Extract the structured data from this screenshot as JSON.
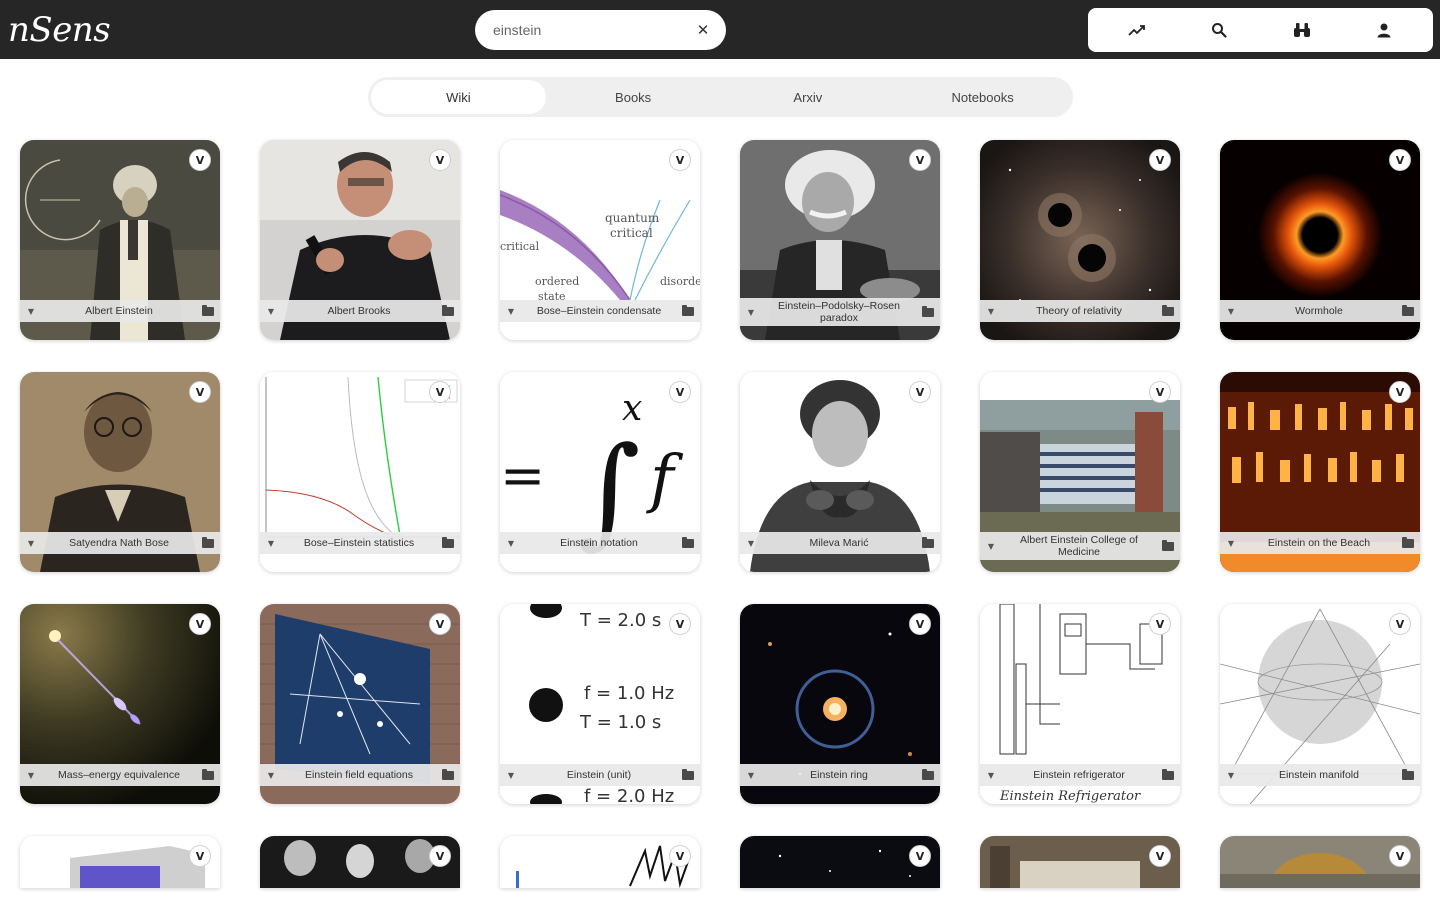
{
  "app": {
    "logo_text": "nSens"
  },
  "search": {
    "value": "einstein",
    "clear_icon": "close-icon",
    "clear_glyph": "✕"
  },
  "toolbar": {
    "icons": [
      "trending-icon",
      "search-icon",
      "binoculars-icon",
      "user-icon"
    ]
  },
  "tabs": [
    {
      "label": "Wiki",
      "active": true
    },
    {
      "label": "Books",
      "active": false
    },
    {
      "label": "Arxiv",
      "active": false
    },
    {
      "label": "Notebooks",
      "active": false
    }
  ],
  "card_badge": "V",
  "card_caption_left_glyph": "▼",
  "rows": [
    [
      {
        "title": "Albert Einstein"
      },
      {
        "title": "Albert Brooks"
      },
      {
        "title": "Bose–Einstein condensate"
      },
      {
        "title": "Einstein–Podolsky–Rosen paradox"
      },
      {
        "title": "Theory of relativity"
      },
      {
        "title": "Wormhole"
      }
    ],
    [
      {
        "title": "Satyendra Nath Bose"
      },
      {
        "title": "Bose–Einstein statistics"
      },
      {
        "title": "Einstein notation"
      },
      {
        "title": "Mileva Marić"
      },
      {
        "title": "Albert Einstein College of Medicine"
      },
      {
        "title": "Einstein on the Beach"
      }
    ],
    [
      {
        "title": "Mass–energy equivalence"
      },
      {
        "title": "Einstein field equations"
      },
      {
        "title": "Einstein (unit)"
      },
      {
        "title": "Einstein ring"
      },
      {
        "title": "Einstein refrigerator"
      },
      {
        "title": "Einstein manifold"
      }
    ],
    [
      {
        "title": ""
      },
      {
        "title": ""
      },
      {
        "title": ""
      },
      {
        "title": ""
      },
      {
        "title": ""
      },
      {
        "title": ""
      }
    ]
  ],
  "card_text": {
    "bec_labels": [
      "quantum",
      "critical",
      "ordered",
      "state",
      "disorde",
      "critical"
    ],
    "notation_symbols": [
      "=",
      "∫",
      "x",
      "f"
    ],
    "unit_lines": [
      "T = 2.0 s",
      "f = 1.0 Hz",
      "T = 1.0 s",
      "f = 2.0 Hz"
    ],
    "refrigerator_caption": "Einstein Refrigerator"
  }
}
